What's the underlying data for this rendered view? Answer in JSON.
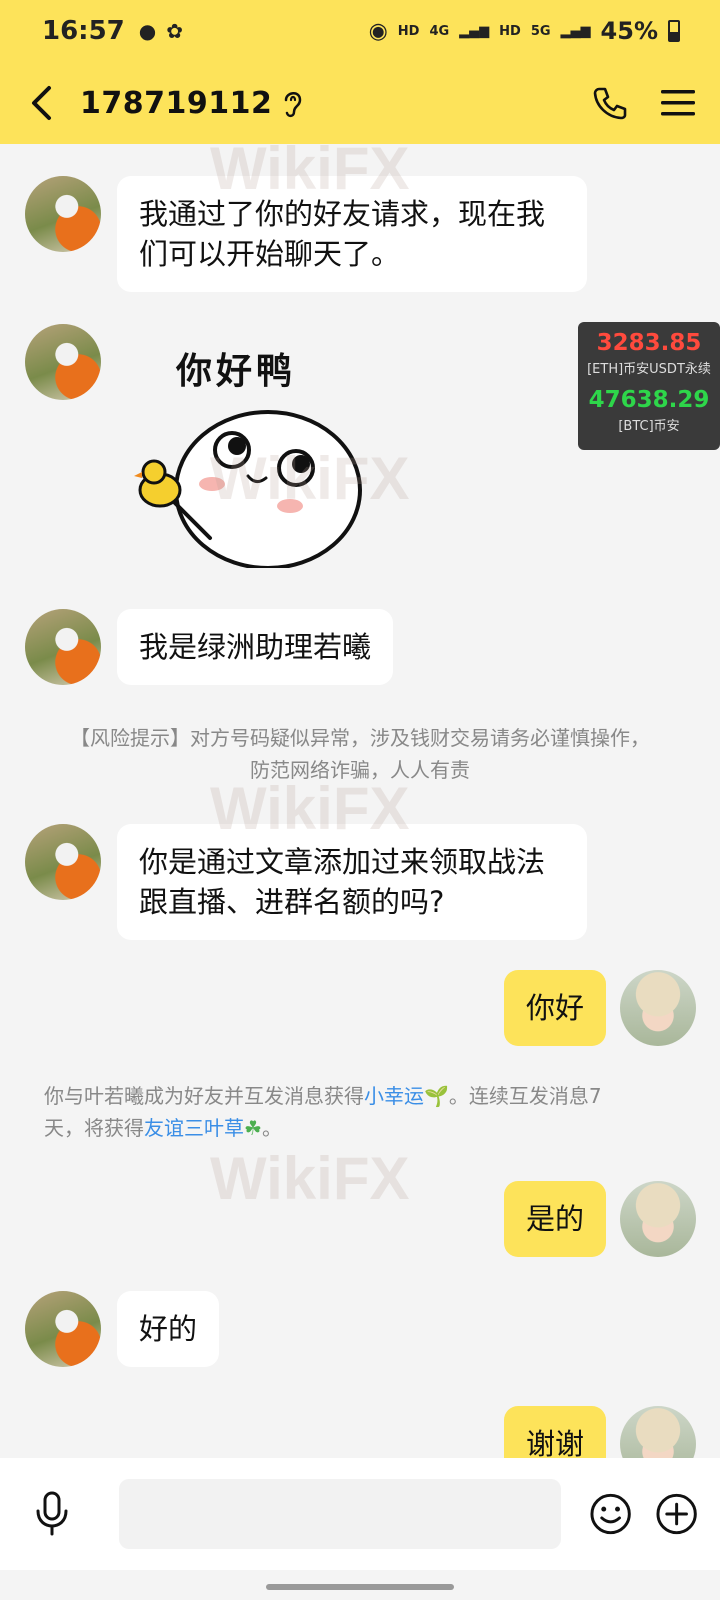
{
  "status_bar": {
    "time": "16:57",
    "network_left": "HD",
    "net_4g": "4G",
    "network_right": "HD",
    "net_5g": "5G",
    "battery": "45%"
  },
  "header": {
    "title": "178719112"
  },
  "messages": [
    {
      "text": "我通过了你的好友请求，现在我们可以开始聊天了。"
    },
    {
      "sticker_text": "你好鸭"
    },
    {
      "text": "我是绿洲助理若曦"
    },
    {
      "text": "你是通过文章添加过来领取战法跟直播、进群名额的吗?"
    },
    {
      "text": "你好"
    },
    {
      "text": "是的"
    },
    {
      "text": "好的"
    },
    {
      "text": "谢谢"
    }
  ],
  "risk_notice": {
    "line1": "【风险提示】对方号码疑似异常，涉及钱财交易请务必谨慎操作，",
    "line2": "防范网络诈骗，人人有责"
  },
  "friend_notice": {
    "part1": "你与叶若曦成为好友并互发消息获得",
    "link1": "小幸运",
    "part2": "。连续互发消息7",
    "part3": "天，将获得",
    "link2": "友谊三叶草",
    "part4": "。"
  },
  "ticker": {
    "eth_price": "3283.85",
    "eth_pair": "[ETH]币安USDT永续",
    "btc_price": "47638.29",
    "btc_pair": "[BTC]币安"
  },
  "watermark": "WikiFX",
  "colors": {
    "header_bg": "#fde35a",
    "self_bubble": "#fde35a",
    "link": "#3a8ee6",
    "eth": "#ff4a3d",
    "btc": "#2ed64a"
  }
}
